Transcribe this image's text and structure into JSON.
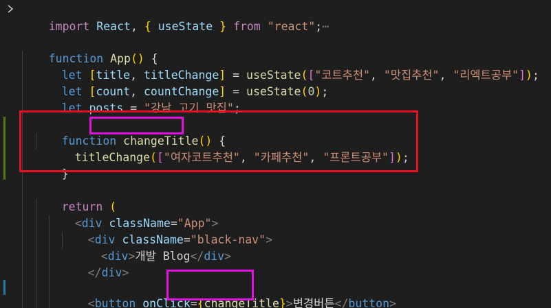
{
  "editor": {
    "line1": {
      "kw": "import",
      "sp1": " ",
      "name": "React",
      "comma": ", ",
      "lbrace": "{",
      "sp2": " ",
      "hook": "useState",
      "sp3": " ",
      "rbrace": "}",
      "sp4": " ",
      "from": "from",
      "sp5": " ",
      "str": "\"react\"",
      "semi": ";",
      "dots": "⋯"
    },
    "line3": {
      "kw": "function",
      "sp": " ",
      "fn": "App",
      "paren": "()",
      "brace": " {"
    },
    "line4": {
      "kw": "let",
      "sp": " ",
      "lb": "[",
      "v1": "title",
      "c": ", ",
      "v2": "titleChange",
      "rb": "]",
      "eq": " = ",
      "fn": "useState",
      "lp": "(",
      "lb2": "[",
      "s1": "\"코트추천\"",
      "c1": ", ",
      "s2": "\"맛집추천\"",
      "c2": ", ",
      "s3": "\"리엑트공부\"",
      "rb2": "]",
      "rp": ")",
      "semi": ";"
    },
    "line5": {
      "kw": "let",
      "sp": " ",
      "lb": "[",
      "v1": "count",
      "c": ", ",
      "v2": "countChange",
      "rb": "]",
      "eq": " = ",
      "fn": "useState",
      "lp": "(",
      "num": "0",
      "rp": ")",
      "semi": ";"
    },
    "line6": {
      "kw": "let",
      "sp": " ",
      "v": "posts",
      "eq": " = ",
      "s": "\"강남 고기 맛집\"",
      "semi": ";"
    },
    "line8": {
      "kw": "function",
      "sp": " ",
      "fn": "changeTitle",
      "paren": "()",
      "brace": " {"
    },
    "line9": {
      "fn": "titleChange",
      "lp": "(",
      "lb": "[",
      "s1": "\"여자코트추천\"",
      "c1": ", ",
      "s2": "\"카페추천\"",
      "c2": ", ",
      "s3": "\"프론트공부\"",
      "rb": "]",
      "rp": ")",
      "semi": ";"
    },
    "line10": {
      "rb": "}"
    },
    "line12": {
      "kw": "return",
      "sp": " ",
      "lp": "("
    },
    "line13": {
      "lt": "<",
      "tag": "div",
      "sp": " ",
      "attr": "className",
      "eq": "=",
      "s": "\"App\"",
      "gt": ">"
    },
    "line14": {
      "lt": "<",
      "tag": "div",
      "sp": " ",
      "attr": "className",
      "eq": "=",
      "s": "\"black-nav\"",
      "gt": ">"
    },
    "line15": {
      "lt": "<",
      "tag": "div",
      "gt": ">",
      "text": "개발 Blog",
      "lt2": "</",
      "tag2": "div",
      "gt2": ">"
    },
    "line16": {
      "lt": "</",
      "tag": "div",
      "gt": ">"
    },
    "line18": {
      "lt": "<",
      "tag": "button",
      "sp": " ",
      "attr": "onClick",
      "eq": "=",
      "lb": "{",
      "fn": "changeTitle",
      "rb": "}",
      "gt": ">",
      "text": "변경버튼",
      "lt2": "</",
      "tag2": "button",
      "gt2": ">"
    }
  },
  "colors": {
    "background": "#1e1e1e",
    "keyword": "#569cd6",
    "control": "#c586c0",
    "string": "#ce9178",
    "function": "#dcdcaa",
    "variable": "#9cdcfe",
    "highlight_red": "#e81123",
    "highlight_magenta": "#e012e0"
  },
  "icons": {
    "fold": "chevron-right-icon"
  }
}
